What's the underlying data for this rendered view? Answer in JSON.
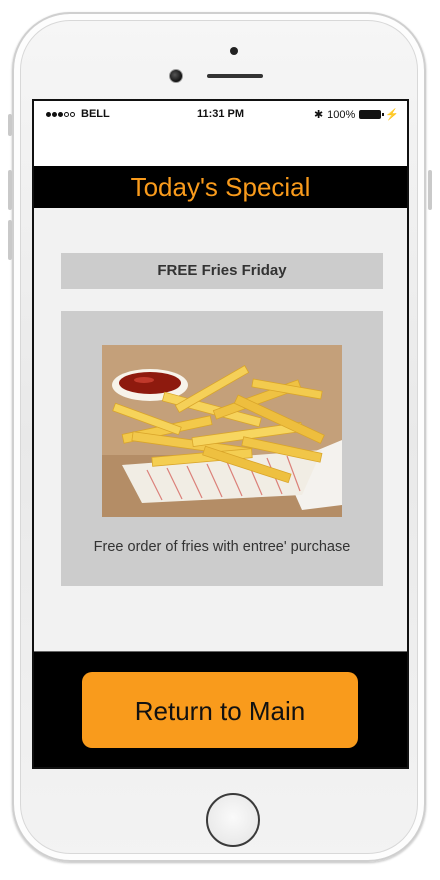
{
  "status_bar": {
    "carrier": "BELL",
    "time": "11:31 PM",
    "battery": "100%",
    "signal_bars_filled": 3,
    "signal_bars_total": 5
  },
  "header": {
    "title": "Today's Special"
  },
  "promo": {
    "title": "FREE Fries Friday",
    "image_icon": "fries-with-ketchup-photo",
    "description": "Free order of fries with entree' purchase"
  },
  "footer": {
    "return_label": "Return to Main"
  },
  "colors": {
    "accent": "#f99b1c",
    "header_bg": "#000000",
    "card_bg": "#cccccc",
    "screen_bg": "#f2f2f2"
  }
}
